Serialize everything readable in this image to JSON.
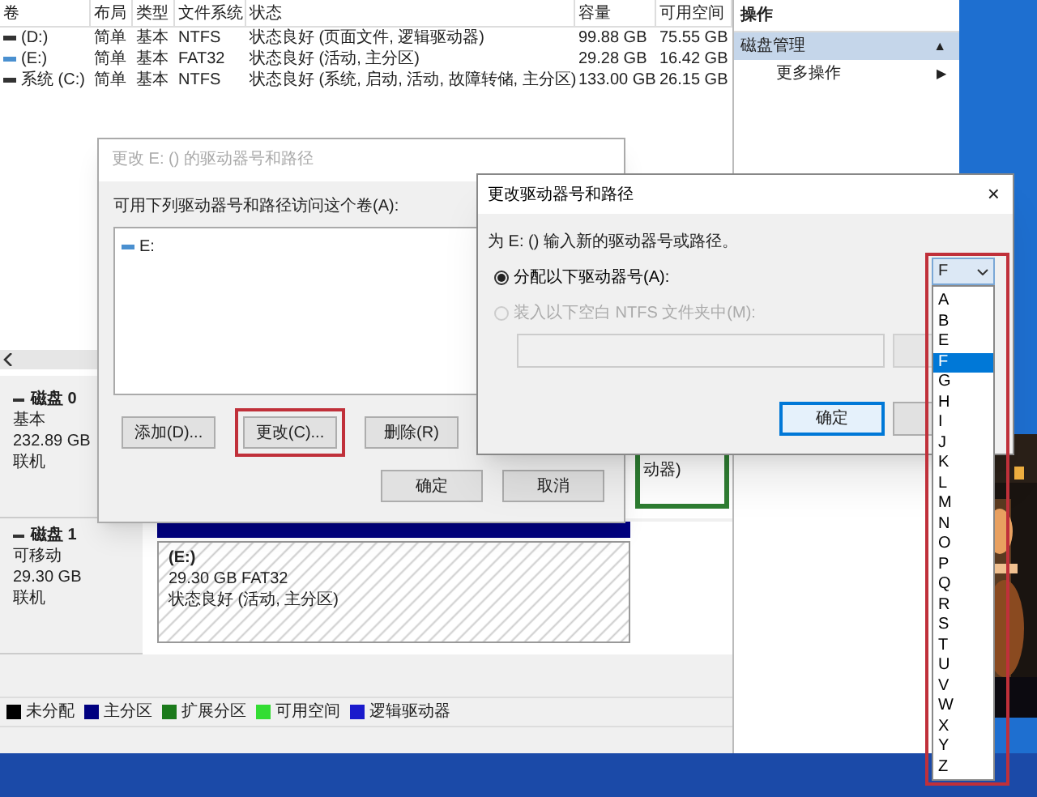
{
  "disk_management": {
    "columns": [
      "卷",
      "布局",
      "类型",
      "文件系统",
      "状态",
      "容量",
      "可用空间"
    ],
    "volumes": [
      {
        "kind": "fixed",
        "cells": [
          "(D:)",
          "简单",
          "基本",
          "NTFS",
          "状态良好 (页面文件, 逻辑驱动器)",
          "99.88 GB",
          "75.55 GB"
        ]
      },
      {
        "kind": "removable",
        "cells": [
          "(E:)",
          "简单",
          "基本",
          "FAT32",
          "状态良好 (活动, 主分区)",
          "29.28 GB",
          "16.42 GB"
        ]
      },
      {
        "kind": "fixed",
        "cells": [
          "系统 (C:)",
          "简单",
          "基本",
          "NTFS",
          "状态良好 (系统, 启动, 活动, 故障转储, 主分区)",
          "133.00 GB",
          "26.15 GB"
        ]
      }
    ],
    "actions": {
      "title": "操作",
      "items": [
        {
          "label": "磁盘管理",
          "selected": true,
          "arrow": "▲",
          "children": [
            {
              "label": "更多操作",
              "selected": false,
              "arrow": "▶"
            }
          ]
        }
      ]
    },
    "disks": [
      {
        "name": "磁盘 0",
        "type": "基本",
        "size": "232.89 GB",
        "status": "联机",
        "partitions": [
          {
            "kind": "fragment",
            "text": "动器)",
            "color": "#2e7d32"
          }
        ]
      },
      {
        "name": "磁盘 1",
        "type": "可移动",
        "size": "29.30 GB",
        "status": "联机",
        "partitions": [
          {
            "kind": "volume",
            "label": "(E:)",
            "size": "29.30 GB FAT32",
            "status": "状态良好 (活动, 主分区)",
            "color": "#000080"
          }
        ]
      }
    ],
    "legend": [
      {
        "label": "未分配",
        "color": "#000000"
      },
      {
        "label": "主分区",
        "color": "#000080"
      },
      {
        "label": "扩展分区",
        "color": "#1b7a1b"
      },
      {
        "label": "可用空间",
        "color": "#33dd33"
      },
      {
        "label": "逻辑驱动器",
        "color": "#1a1acc"
      }
    ]
  },
  "paths_dialog": {
    "title": "更改 E: () 的驱动器号和路径",
    "active": false,
    "prompt": "可用下列驱动器号和路径访问这个卷(A):",
    "entries": [
      {
        "label": "E:"
      }
    ],
    "buttons": [
      {
        "label": "添加(D)...",
        "highlighted": false
      },
      {
        "label": "更改(C)...",
        "highlighted": true
      },
      {
        "label": "删除(R)",
        "highlighted": false
      }
    ],
    "ok": "确定",
    "cancel": "取消"
  },
  "change_dialog": {
    "title": "更改驱动器号和路径",
    "active": true,
    "close": "×",
    "prompt": "为 E: () 输入新的驱动器号或路径。",
    "options": [
      {
        "label": "分配以下驱动器号(A):",
        "selected": true,
        "disabled": false
      },
      {
        "label": "装入以下空白 NTFS 文件夹中(M):",
        "selected": false,
        "disabled": true
      }
    ],
    "path_field": {
      "disabled": true
    },
    "ok": "确定",
    "dropdown": {
      "value": "F",
      "highlighted": true,
      "options": [
        {
          "label": "A",
          "selected": false
        },
        {
          "label": "B",
          "selected": false
        },
        {
          "label": "E",
          "selected": false
        },
        {
          "label": "F",
          "selected": true
        },
        {
          "label": "G",
          "selected": false
        },
        {
          "label": "H",
          "selected": false
        },
        {
          "label": "I",
          "selected": false
        },
        {
          "label": "J",
          "selected": false
        },
        {
          "label": "K",
          "selected": false
        },
        {
          "label": "L",
          "selected": false
        },
        {
          "label": "M",
          "selected": false
        },
        {
          "label": "N",
          "selected": false
        },
        {
          "label": "O",
          "selected": false
        },
        {
          "label": "P",
          "selected": false
        },
        {
          "label": "Q",
          "selected": false
        },
        {
          "label": "R",
          "selected": false
        },
        {
          "label": "S",
          "selected": false
        },
        {
          "label": "T",
          "selected": false
        },
        {
          "label": "U",
          "selected": false
        },
        {
          "label": "V",
          "selected": false
        },
        {
          "label": "W",
          "selected": false
        },
        {
          "label": "X",
          "selected": false
        },
        {
          "label": "Y",
          "selected": false
        },
        {
          "label": "Z",
          "selected": false
        }
      ]
    }
  }
}
